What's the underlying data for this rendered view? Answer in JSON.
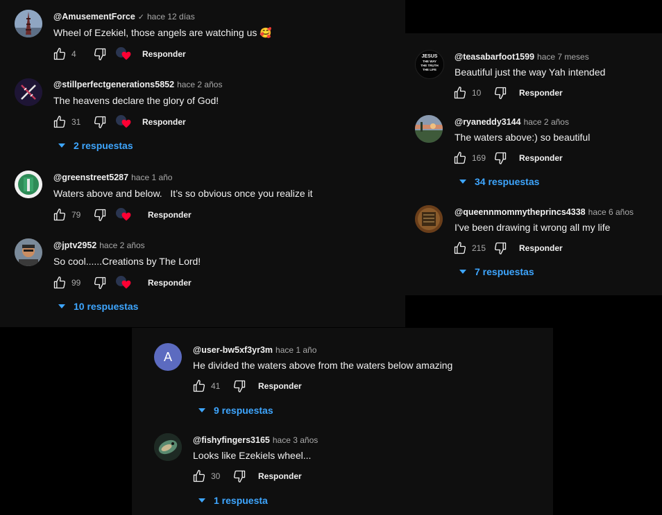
{
  "panel_a": {
    "comments": [
      {
        "handle": "@AmusementForce",
        "time": "hace 12 días",
        "text": "Wheel of Ezekiel, those angels are watching us 🥰",
        "likes": "4",
        "reply_label": "Responder"
      },
      {
        "handle": "@stillperfectgenerations5852",
        "time": "hace 2 años",
        "text": "The heavens declare the glory of God!",
        "likes": "31",
        "reply_label": "Responder",
        "replies": "2 respuestas"
      },
      {
        "handle": "@greenstreet5287",
        "time": "hace 1 año",
        "text": "Waters above and below.   It’s so obvious once you realize it",
        "likes": "79",
        "reply_label": "Responder"
      },
      {
        "handle": "@jptv2952",
        "time": "hace 2 años",
        "text": "So cool......Creations by The Lord!",
        "likes": "99",
        "reply_label": "Responder",
        "replies": "10 respuestas"
      }
    ]
  },
  "panel_b": {
    "comments": [
      {
        "handle": "@teasabarfoot1599",
        "time": "hace 7 meses",
        "text": "Beautiful just the way Yah intended",
        "likes": "10",
        "reply_label": "Responder",
        "avatar_text": [
          "JESUS",
          "THE WAY",
          "THE TRUTH",
          "THE LIFE"
        ]
      },
      {
        "handle": "@ryaneddy3144",
        "time": "hace 2 años",
        "text": "The waters above:) so beautiful",
        "likes": "169",
        "reply_label": "Responder",
        "replies": "34 respuestas"
      },
      {
        "handle": "@queennmommytheprincs4338",
        "time": "hace 6 años",
        "text": "I've been drawing it wrong all my life",
        "likes": "215",
        "reply_label": "Responder",
        "replies": "7 respuestas"
      }
    ]
  },
  "panel_c": {
    "comments": [
      {
        "handle": "@user-bw5xf3yr3m",
        "time": "hace 1 año",
        "text": "He divided the waters above from the waters below amazing",
        "likes": "41",
        "reply_label": "Responder",
        "replies": "9 respuestas",
        "avatar_letter": "A"
      },
      {
        "handle": "@fishyfingers3165",
        "time": "hace 3 años",
        "text": "Looks like Ezekiels wheel...",
        "likes": "30",
        "reply_label": "Responder",
        "replies": "1 respuesta"
      }
    ]
  },
  "icons": {
    "like": "thumb-up-icon",
    "dislike": "thumb-down-icon",
    "creator_heart": "creator-heart-icon",
    "verified": "verified-check-icon",
    "expand": "triangle-down-icon"
  },
  "colors": {
    "background": "#0f0f0f",
    "text": "#f1f1f1",
    "muted": "#aaaaaa",
    "link": "#3ea6ff",
    "heart": "#ff0033",
    "avatar_letter_bg": "#5c6bc0"
  }
}
